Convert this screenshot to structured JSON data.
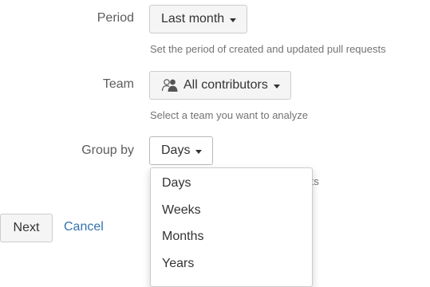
{
  "form": {
    "period": {
      "label": "Period",
      "value": "Last month",
      "help": "Set the period of created and updated pull requests"
    },
    "team": {
      "label": "Team",
      "icon": "users-icon",
      "value": "All contributors",
      "help": "Select a team you want to analyze"
    },
    "group_by": {
      "label": "Group by",
      "value": "Days",
      "help_visible_fragment": "ests",
      "options": [
        "Days",
        "Weeks",
        "Months",
        "Years"
      ]
    }
  },
  "actions": {
    "next_label": "Next",
    "cancel_label": "Cancel"
  },
  "colors": {
    "link": "#3572b0",
    "label": "#5c5c5c",
    "help": "#737373",
    "button_bg": "#f5f5f5",
    "border": "#cccccc"
  }
}
